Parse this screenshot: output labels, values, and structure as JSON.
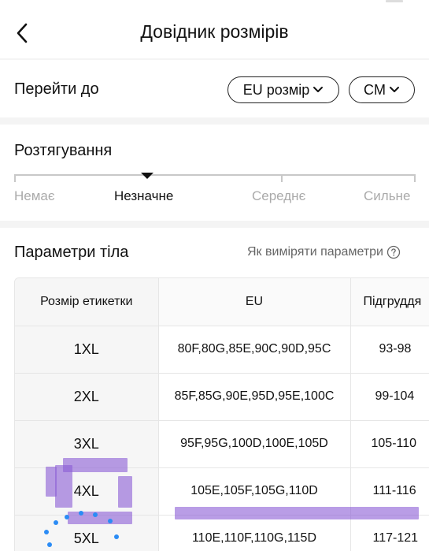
{
  "header": {
    "title": "Довідник розмірів",
    "back_icon": "chevron-left-icon"
  },
  "goto": {
    "label": "Перейти до",
    "size_system": "EU розмір",
    "unit": "CM"
  },
  "stretch": {
    "title": "Розтягування",
    "levels": [
      "Немає",
      "Незначне",
      "Середнє",
      "Сильне"
    ],
    "selected": "Незначне"
  },
  "params": {
    "title": "Параметри тіла",
    "howto": "Як виміряти параметри"
  },
  "table": {
    "headers": [
      "Розмір етикетки",
      "EU",
      "Підгруддя"
    ],
    "rows": [
      [
        "1XL",
        "80F,80G,85E,90C,90D,95C",
        "93-98"
      ],
      [
        "2XL",
        "85F,85G,90E,95D,95E,100C",
        "99-104"
      ],
      [
        "3XL",
        "95F,95G,100D,100E,105D",
        "105-110"
      ],
      [
        "4XL",
        "105E,105F,105G,110D",
        "111-116"
      ],
      [
        "5XL",
        "110E,110F,110G,115D",
        "117-121"
      ]
    ]
  },
  "colors": {
    "highlight": "#8a5cd6",
    "dots": "#2b8cf5",
    "accent": "#111111"
  }
}
